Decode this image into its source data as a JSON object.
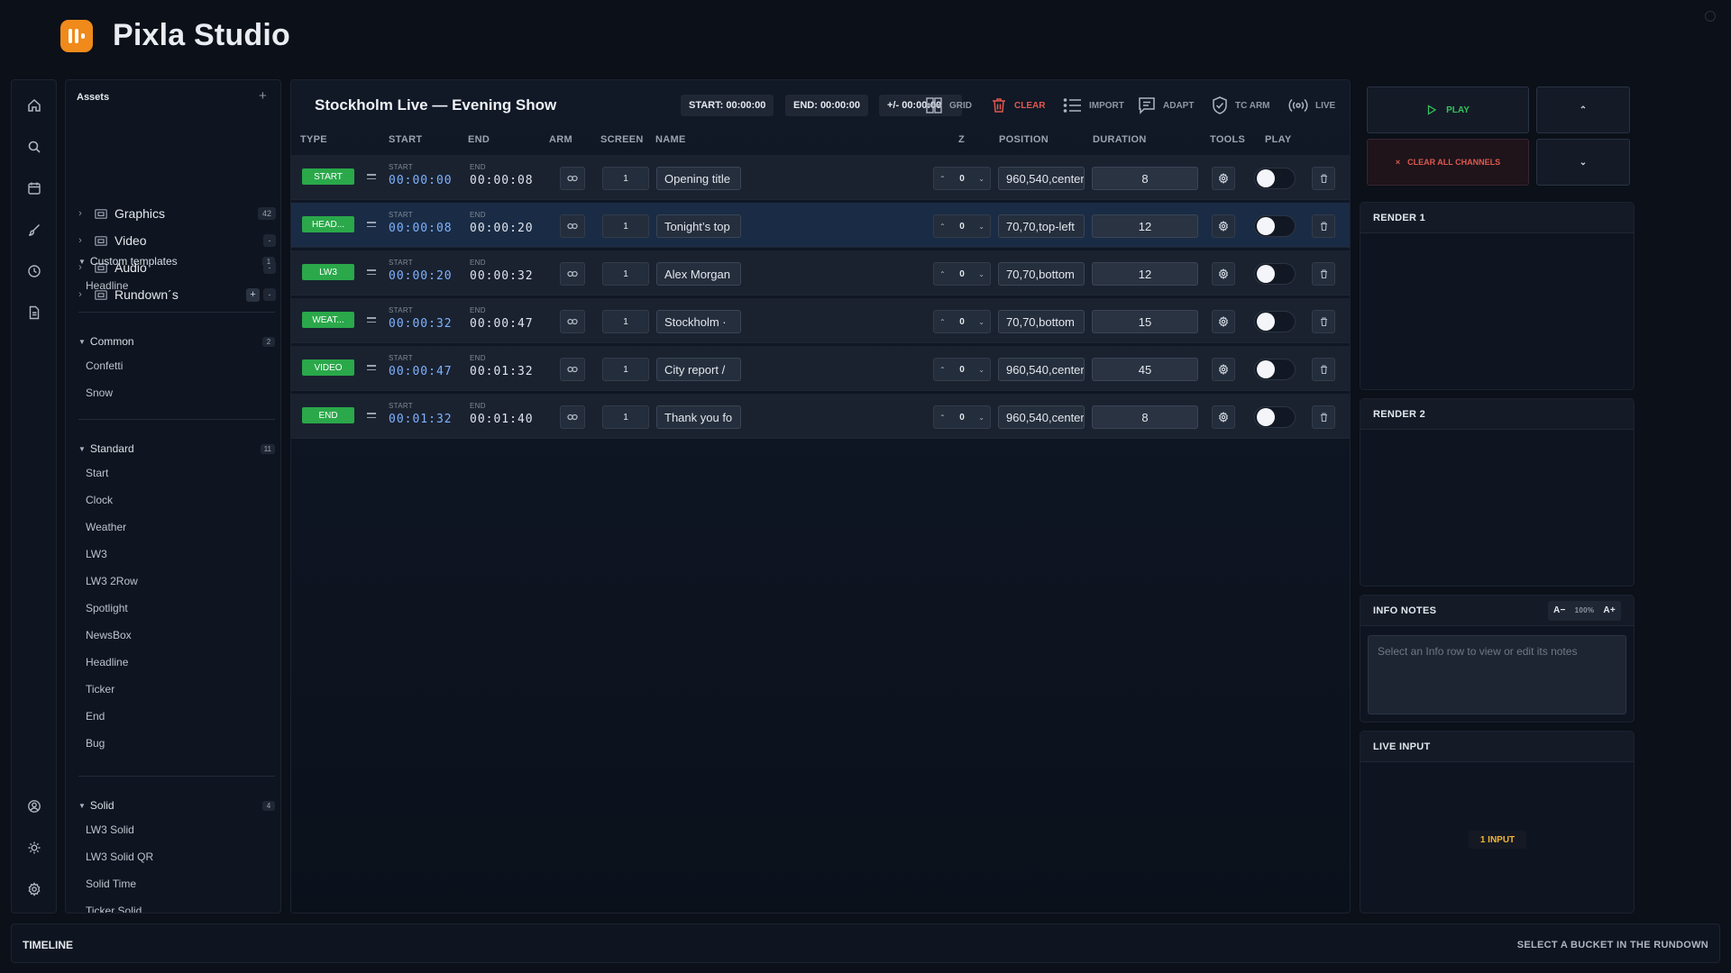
{
  "app": {
    "title": "Pixla Studio"
  },
  "assets": {
    "title": "Assets",
    "add_icon": "plus-icon",
    "libraries": [
      {
        "label": "Graphics",
        "count": "42"
      },
      {
        "label": "Video",
        "count": "-"
      },
      {
        "label": "Audio",
        "count": "-"
      },
      {
        "label": "Rundown´s",
        "count": "-",
        "add": "+"
      }
    ],
    "sections": [
      {
        "label": "Custom templates",
        "count": "1",
        "items": [
          "Headline"
        ]
      },
      {
        "label": "Common",
        "count": "2",
        "items": [
          "Confetti",
          "Snow"
        ]
      },
      {
        "label": "Standard",
        "count": "11",
        "items": [
          "Start",
          "Clock",
          "Weather",
          "LW3",
          "LW3 2Row",
          "Spotlight",
          "NewsBox",
          "Headline",
          "Ticker",
          "End",
          "Bug"
        ]
      },
      {
        "label": "Solid",
        "count": "4",
        "items": [
          "LW3 Solid",
          "LW3 Solid QR",
          "Solid Time",
          "Ticker Solid"
        ]
      }
    ]
  },
  "rundown": {
    "title": "Stockholm Live — Evening Show",
    "start_pill": "START:  00:00:00",
    "end_pill": "END:  00:00:00",
    "offset_pill": "+/-  00:00:00",
    "toolbar": {
      "grid": "GRID",
      "clear": "CLEAR",
      "import": "IMPORT",
      "adapt": "ADAPT",
      "tc_arm": "TC ARM",
      "live": "LIVE"
    },
    "columns": {
      "type": "TYPE",
      "start": "START",
      "end": "END",
      "arm": "ARM",
      "screen": "SCREEN",
      "name": "NAME",
      "z": "Z",
      "position": "POSITION",
      "duration": "DURATION",
      "tools": "TOOLS",
      "play": "PLAY"
    },
    "time_labels": {
      "start": "START",
      "end": "END"
    },
    "rows": [
      {
        "type": "START",
        "start": "00:00:00",
        "end": "00:00:08",
        "screen": "1",
        "name": "Opening title",
        "z": "0",
        "position": "960,540,center",
        "duration": "8",
        "selected": false
      },
      {
        "type": "HEAD...",
        "start": "00:00:08",
        "end": "00:00:20",
        "screen": "1",
        "name": "Tonight’s top",
        "z": "0",
        "position": "70,70,top-left",
        "duration": "12",
        "selected": true
      },
      {
        "type": "LW3",
        "start": "00:00:20",
        "end": "00:00:32",
        "screen": "1",
        "name": "Alex Morgan",
        "z": "0",
        "position": "70,70,bottom",
        "duration": "12",
        "selected": false
      },
      {
        "type": "WEAT...",
        "start": "00:00:32",
        "end": "00:00:47",
        "screen": "1",
        "name": "Stockholm ·",
        "z": "0",
        "position": "70,70,bottom",
        "duration": "15",
        "selected": false
      },
      {
        "type": "VIDEO",
        "start": "00:00:47",
        "end": "00:01:32",
        "screen": "1",
        "name": "City report /",
        "z": "0",
        "position": "960,540,center",
        "duration": "45",
        "selected": false
      },
      {
        "type": "END",
        "start": "00:01:32",
        "end": "00:01:40",
        "screen": "1",
        "name": "Thank you fo",
        "z": "0",
        "position": "960,540,center",
        "duration": "8",
        "selected": false
      }
    ]
  },
  "controls": {
    "play": "PLAY",
    "clear_all": "CLEAR ALL CHANNELS"
  },
  "render1": {
    "title": "RENDER 1"
  },
  "render2": {
    "title": "RENDER 2"
  },
  "info_notes": {
    "title": "INFO NOTES",
    "font_down": "A−",
    "zoom": "100%",
    "font_up": "A+",
    "placeholder": "Select an Info row to view or edit its notes"
  },
  "live_input": {
    "title": "LIVE INPUT",
    "badge": "1 INPUT"
  },
  "timeline": {
    "title": "TIMELINE",
    "hint": "SELECT A BUCKET IN THE RUNDOWN"
  },
  "colors": {
    "accent": "#f08a1a",
    "type_badge": "#2aa84a",
    "start_time": "#7fb2ff",
    "clear": "#e0584f",
    "live_badge": "#f2b636"
  }
}
